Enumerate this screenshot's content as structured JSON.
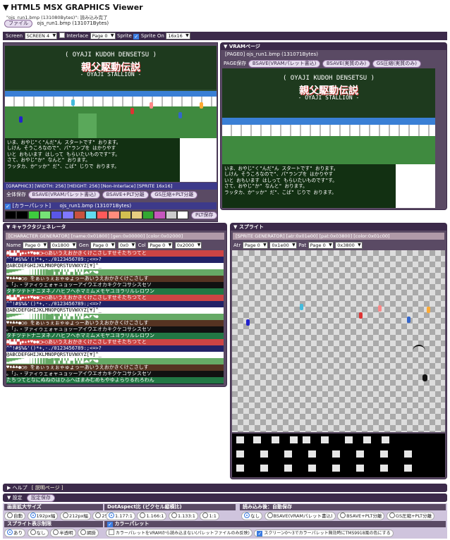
{
  "app": {
    "title": "HTML5 MSX GRAPHICS Viewer",
    "status": "\"ojs_run1.bmp (131080Bytes)\": 読み込み完了",
    "file_button": "ファイル",
    "file_name": "ojs_run1.bmp (131071Bytes)"
  },
  "screenbar": {
    "screen_label": "Screen",
    "screen_value": "SCREEN 4",
    "interlace_label": "Interlace",
    "page_value": "Page 0",
    "sprite_label": "Sprite",
    "sprite_on_label": "Sprite On",
    "sprite_size_value": "16x16"
  },
  "game": {
    "line1": "( OYAJI  KUDOH  DENSETSU )",
    "line2": "親父駆動伝説",
    "line3": "- OYAJI  STALLION -",
    "dialog": [
      "いま、おやじ\"く\"んだ\"ん スタートです\"  おります。",
      "  しけん そうころなので\"、パ\"ランプを はかりやす",
      "いと おもいます はしって もらいたいものです\"す。",
      "さて、おやじ\"か\"  なんと\"  おります。",
      "ラッタカ、か\"ッか\"  だ\"、こば\" じりで   おります。"
    ]
  },
  "main": {
    "info": "[GRAPHIC3] [WIDTH: 256] [HEIGHT: 256] [Non-Interlace] [SPRITE 16x16]",
    "save_label": "全体保存",
    "bsave_button": "BSAVE(VRAMパレット書込)",
    "bsave_plt_button": "BSAVE+PLT分離",
    "gs_button": "GS圧縮+PLT分離",
    "palette_label": "[カラーパレット]",
    "palette_file": "ojs_run1.bmp (131071Bytes)",
    "plt_save": "PLT保存"
  },
  "palette": [
    "#000000",
    "#000000",
    "#3ecc3e",
    "#76e276",
    "#5a56e8",
    "#8078ff",
    "#c8523e",
    "#60dcf0",
    "#ff5a5a",
    "#ff8c7c",
    "#d2c050",
    "#e6ce80",
    "#32a832",
    "#c656be",
    "#cccccc",
    "#ffffff"
  ],
  "vram": {
    "title": "VRAMページ",
    "page_label": "[PAGE0] ojs_run1.bmp (131071Bytes)",
    "save_label": "PAGE保存",
    "bsave_button": "BSAVE(VRAMパレット書込)",
    "bsave_only": "BSAVE(実質のみ)",
    "gs_only": "GS圧縮(実質のみ)"
  },
  "chargen": {
    "title": "キャラクタジェネレータ",
    "info": "[CHARACTER GENERATOR]   [name:0x01800] [gen:0x00000] [color:0x02000]",
    "name_label": "Name",
    "name_page": "Page 0",
    "name_addr": "0x1800",
    "gen_label": "Gen",
    "gen_page": "Page 0",
    "gen_addr": "0x0",
    "col_label": "Col",
    "col_page": "Page 0",
    "col_addr": "0x2000",
    "rows": [
      "☗▙▟▞▚◆★♦♥●●□←○あいうえおかきくけこさしすせそたちつてと",
      "^^!#$%&'()*+,-./0123456789:;<=>?",
      "@ABCDEFGHIJKLMNOPQRSTUVWXYZ[¥]^_",
      "▂▃▄▅▆▇█▉▊▋▌▍▎▏▔▕▖▗▘▙▚▛▜▝▞▟◢◣◤◥●",
      "♥♦♣♠●○◎ をぁぃぅぇぉゃゅょっーあいうえおかきくけこさしす",
      "。「」、・ヲァィゥェォャュョッーアイウエオカキクケコサシスセソ",
      "タチツテトナニヌネノハヒフヘホマミムメモヤユヨラリルレロワン",
      "たちつてとなにぬねのはひふへほまみむめもやゆよらりるれろわん"
    ]
  },
  "sprite": {
    "title": "スプライト",
    "info": "[SPRITE GENERATOR]   [atr:0x01e00] [pat:0x03800] [color:0x01c00]",
    "atr_label": "Atr",
    "atr_page": "Page 0",
    "atr_addr": "0x1e00",
    "pat_label": "Pat",
    "pat_page": "Page 0",
    "pat_addr": "0x3800"
  },
  "footer": {
    "help_label": "ヘルプ",
    "help_link": "[ 説明ページ ]",
    "settings_label": "設定",
    "settings_save": "設定保存"
  },
  "settings": {
    "size_title": "画面拡大サイズ",
    "size_options": [
      "自動",
      "192px幅",
      "212px幅",
      "256px幅"
    ],
    "dot_title": "DotAspect比 (ピクセル縦横比)",
    "dot_options": [
      "1.177:1",
      "1.166:1",
      "1.133:1",
      "1:1"
    ],
    "load_title": "読み込み後：自動保存",
    "load_options": [
      "なし",
      "BSAVE(VRAMパレット書込)",
      "BSAVE+PLT分離",
      "GS圧縮+PLT分離"
    ],
    "sprite_title": "スプライト表示制限",
    "sprite_options": [
      "あり",
      "なし",
      "半透明",
      "網掛"
    ],
    "palette_title": "カラーパレット",
    "palette_opt1": "カラーパレットをVRAMから読み込まない(パレットファイルのみ反映)",
    "palette_opt2": "スクリーン0～3でカラーパレット無効時にTMS9918風の色にする"
  }
}
